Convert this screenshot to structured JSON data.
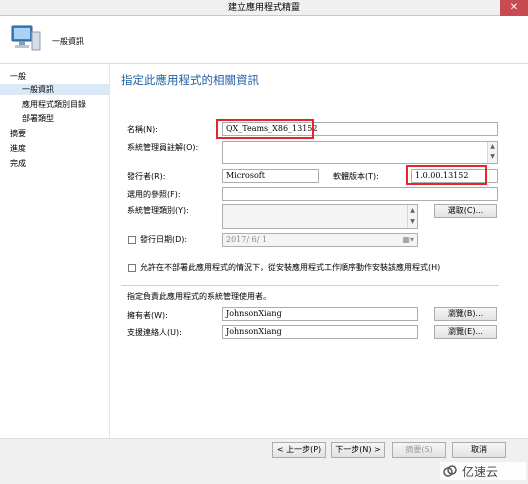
{
  "window": {
    "title": "建立應用程式精靈",
    "close_glyph": "✕"
  },
  "header": {
    "page_label": "一般資訊",
    "icon": "computer-icon"
  },
  "nav": {
    "items": [
      {
        "label": "一般",
        "level": 0,
        "selected": false
      },
      {
        "label": "一般資訊",
        "level": 1,
        "selected": true
      },
      {
        "label": "應用程式類別目錄",
        "level": 1,
        "selected": false
      },
      {
        "label": "部署類型",
        "level": 1,
        "selected": false
      },
      {
        "label": "摘要",
        "level": 0,
        "selected": false
      },
      {
        "label": "進度",
        "level": 0,
        "selected": false
      },
      {
        "label": "完成",
        "level": 0,
        "selected": false
      }
    ]
  },
  "main": {
    "heading": "指定此應用程式的相關資訊",
    "name_label": "名稱(N):",
    "name_value": "QX_Teams_X86_13152",
    "comment_label": "系統管理員註解(O):",
    "comment_value": "",
    "publisher_label": "發行者(R):",
    "publisher_value": "Microsoft",
    "version_label": "軟體版本(T):",
    "version_value": "1.0.00.13152",
    "reference_label": "選用的參照(F):",
    "reference_value": "",
    "category_label": "系統管理類別(Y):",
    "category_value": "",
    "select_button": "選取(C)...",
    "publish_date_label": "發行日期(D):",
    "publish_date_value": "2017/ 6/ 1",
    "install_checkbox_label": "允許在不部署此應用程式的情況下，從安裝應用程式工作順序動作安裝該應用程式(H)",
    "contacts_heading": "指定負責此應用程式的系統管理使用者。",
    "owner_label": "擁有者(W):",
    "owner_value": "JohnsonXiang",
    "owner_browse": "瀏覽(B)...",
    "support_label": "支援連絡人(U):",
    "support_value": "JohnsonXiang",
    "support_browse": "瀏覽(E)..."
  },
  "footer": {
    "prev": "< 上一步(P)",
    "next": "下一步(N) >",
    "summary": "摘要(S)",
    "cancel": "取消"
  },
  "watermark": "亿速云",
  "colors": {
    "accent": "#1f5fa6",
    "highlight": "#e0282e",
    "nav_selected": "#dbe8f6"
  }
}
